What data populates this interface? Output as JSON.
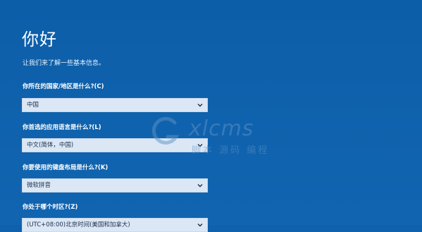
{
  "page": {
    "title": "你好",
    "subtitle": "让我们来了解一些基本信息。"
  },
  "fields": [
    {
      "label": "你所在的国家/地区是什么?(C)",
      "value": "中国"
    },
    {
      "label": "你首选的应用语言是什么?(L)",
      "value": "中文(简体，中国)"
    },
    {
      "label": "你要使用的键盘布局是什么?(K)",
      "value": "微软拼音"
    },
    {
      "label": "你处于哪个时区?(Z)",
      "value": "(UTC+08:00)北京时间(美国和加拿大)"
    }
  ],
  "watermark": {
    "brand": "xlcms",
    "tagline": "脚本 源码 编程"
  },
  "icons": {
    "dropdown": "chevron-down-icon",
    "watermark_logo": "g-logo-icon"
  },
  "colors": {
    "background": "#0f60ad",
    "field_background": "#dbe7f5",
    "text": "#ffffff",
    "watermark": "#5f92c7"
  }
}
